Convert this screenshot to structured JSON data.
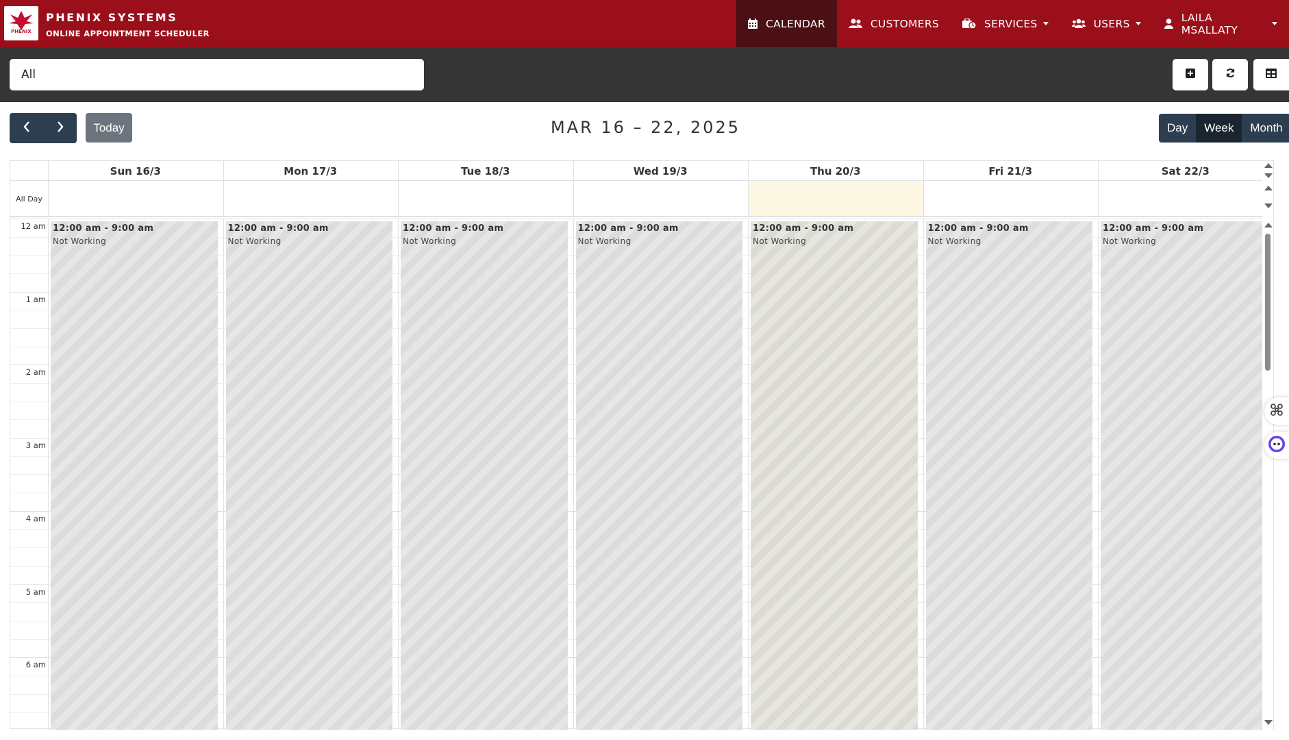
{
  "brand": {
    "title": "PHENIX SYSTEMS",
    "subtitle": "ONLINE APPOINTMENT SCHEDULER",
    "logo_text": "PHENIX"
  },
  "nav": {
    "calendar": "CALENDAR",
    "customers": "CUSTOMERS",
    "services": "SERVICES",
    "users": "USERS",
    "account": "LAILA MSALLATY"
  },
  "filter": {
    "selected": "All"
  },
  "toolbar": {
    "today": "Today",
    "range_title": "MAR 16 – 22, 2025",
    "views": {
      "day": "Day",
      "week": "Week",
      "month": "Month"
    },
    "active_view": "Week"
  },
  "calendar": {
    "all_day_label": "All Day",
    "days": [
      {
        "label": "Sun 16/3",
        "today": false
      },
      {
        "label": "Mon 17/3",
        "today": false
      },
      {
        "label": "Tue 18/3",
        "today": false
      },
      {
        "label": "Wed 19/3",
        "today": false
      },
      {
        "label": "Thu 20/3",
        "today": true
      },
      {
        "label": "Fri 21/3",
        "today": false
      },
      {
        "label": "Sat 22/3",
        "today": false
      }
    ],
    "hours": [
      "12 am",
      "1 am",
      "2 am",
      "3 am",
      "4 am",
      "5 am",
      "6 am"
    ],
    "event": {
      "time": "12:00 am - 9:00 am",
      "title": "Not Working"
    }
  },
  "colors": {
    "navbar": "#9b0f1a",
    "navbar_active": "#4b1014",
    "filterbar": "#353535",
    "button_dark": "#2c3e50",
    "today_highlight": "#fcf8e3"
  }
}
